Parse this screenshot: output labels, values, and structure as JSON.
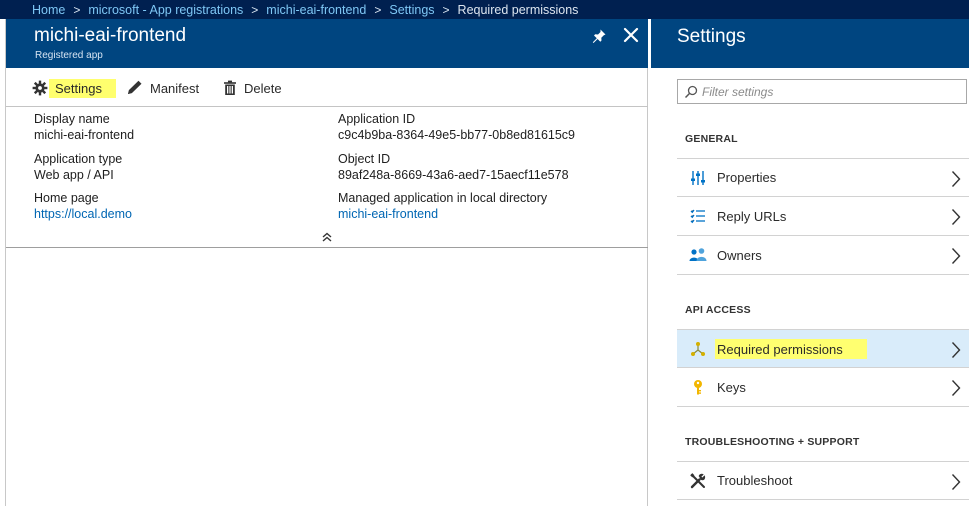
{
  "breadcrumb": {
    "items": [
      "Home",
      "microsoft - App registrations",
      "michi-eai-frontend",
      "Settings"
    ],
    "current": "Required permissions",
    "separator": ">"
  },
  "app_blade": {
    "title": "michi-eai-frontend",
    "subtitle": "Registered app",
    "toolbar": {
      "settings_label": "Settings",
      "manifest_label": "Manifest",
      "delete_label": "Delete"
    },
    "properties": {
      "display_name_label": "Display name",
      "display_name_value": "michi-eai-frontend",
      "application_type_label": "Application type",
      "application_type_value": "Web app / API",
      "home_page_label": "Home page",
      "home_page_value": "https://local.demo",
      "application_id_label": "Application ID",
      "application_id_value": "c9c4b9ba-8364-49e5-bb77-0b8ed81615c9",
      "object_id_label": "Object ID",
      "object_id_value": "89af248a-8669-43a6-aed7-15aecf11e578",
      "managed_app_label": "Managed application in local directory",
      "managed_app_value": "michi-eai-frontend"
    }
  },
  "settings_blade": {
    "title": "Settings",
    "filter_placeholder": "Filter settings",
    "sections": {
      "general": "GENERAL",
      "api_access": "API ACCESS",
      "troubleshooting": "TROUBLESHOOTING + SUPPORT"
    },
    "general_items": [
      "Properties",
      "Reply URLs",
      "Owners"
    ],
    "api_items": [
      "Required permissions",
      "Keys"
    ],
    "support_items": [
      "Troubleshoot"
    ],
    "active_item": "Required permissions"
  },
  "colors": {
    "header_blue": "#004580",
    "breadcrumb_bg": "#002050",
    "link_blue": "#0066b3",
    "highlight_yellow": "#ffff6e",
    "active_row": "#d9ecfa"
  },
  "icons": {
    "pin": "pin-icon",
    "close": "close-icon",
    "settings": "gear-icon",
    "manifest": "pencil-icon",
    "delete": "trash-icon",
    "filter": "search-icon",
    "properties": "sliders-icon",
    "reply_urls": "list-icon",
    "owners": "people-icon",
    "required_permissions": "permissions-icon",
    "keys": "key-icon",
    "troubleshoot": "tools-icon",
    "collapse": "double-chevron-up-icon",
    "chevron": "chevron-right-icon"
  }
}
